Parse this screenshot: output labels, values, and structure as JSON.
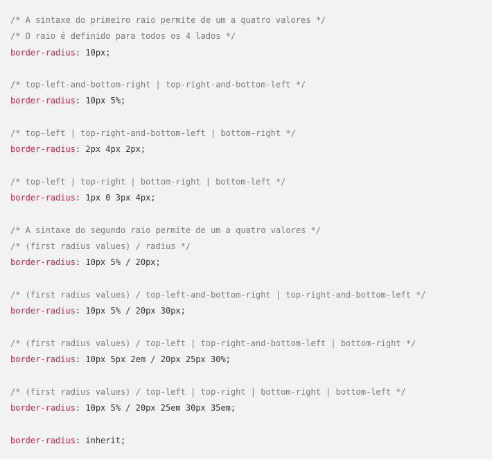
{
  "lines": [
    {
      "type": "comment",
      "text": "/* A sintaxe do primeiro raio permite de um a quatro valores */"
    },
    {
      "type": "comment",
      "text": "/* O raio é definido para todos os 4 lados */"
    },
    {
      "type": "decl",
      "prop": "border-radius",
      "value": "10px;"
    },
    {
      "type": "blank"
    },
    {
      "type": "comment",
      "text": "/* top-left-and-bottom-right | top-right-and-bottom-left */"
    },
    {
      "type": "decl",
      "prop": "border-radius",
      "value": "10px 5%;"
    },
    {
      "type": "blank"
    },
    {
      "type": "comment",
      "text": "/* top-left | top-right-and-bottom-left | bottom-right */"
    },
    {
      "type": "decl",
      "prop": "border-radius",
      "value": "2px 4px 2px;"
    },
    {
      "type": "blank"
    },
    {
      "type": "comment",
      "text": "/* top-left | top-right | bottom-right | bottom-left */"
    },
    {
      "type": "decl",
      "prop": "border-radius",
      "value": "1px 0 3px 4px;"
    },
    {
      "type": "blank"
    },
    {
      "type": "comment",
      "text": "/* A sintaxe do segundo raio permite de um a quatro valores */"
    },
    {
      "type": "comment",
      "text": "/* (first radius values) / radius */"
    },
    {
      "type": "decl",
      "prop": "border-radius",
      "value": "10px 5% / 20px;"
    },
    {
      "type": "blank"
    },
    {
      "type": "comment",
      "text": "/* (first radius values) / top-left-and-bottom-right | top-right-and-bottom-left */"
    },
    {
      "type": "decl",
      "prop": "border-radius",
      "value": "10px 5% / 20px 30px;"
    },
    {
      "type": "blank"
    },
    {
      "type": "comment",
      "text": "/* (first radius values) / top-left | top-right-and-bottom-left | bottom-right */"
    },
    {
      "type": "decl",
      "prop": "border-radius",
      "value": "10px 5px 2em / 20px 25px 30%;"
    },
    {
      "type": "blank"
    },
    {
      "type": "comment",
      "text": "/* (first radius values) / top-left | top-right | bottom-right | bottom-left */"
    },
    {
      "type": "decl",
      "prop": "border-radius",
      "value": "10px 5% / 20px 25em 30px 35em;"
    },
    {
      "type": "blank"
    },
    {
      "type": "decl",
      "prop": "border-radius",
      "value": "inherit;"
    }
  ],
  "colors": {
    "background": "#f2f2f2",
    "comment": "#7a7a7a",
    "property": "#c7254e",
    "text": "#333333"
  }
}
